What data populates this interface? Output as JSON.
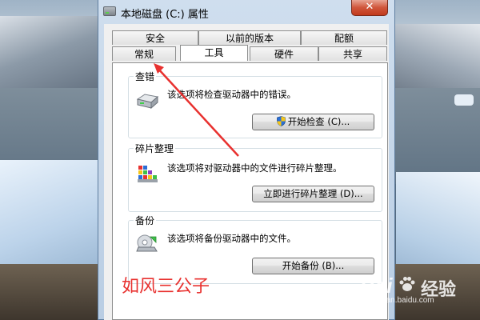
{
  "window": {
    "title": "本地磁盘 (C:) 属性",
    "close_label": "✕"
  },
  "tabs": {
    "row_back": [
      "安全",
      "以前的版本",
      "配额"
    ],
    "row_front": [
      "常规",
      "工具",
      "硬件",
      "共享"
    ],
    "active": "工具"
  },
  "groups": {
    "check": {
      "title": "查错",
      "description": "该选项将检查驱动器中的错误。",
      "button": "开始检查 (C)..."
    },
    "defrag": {
      "title": "碎片整理",
      "description": "该选项将对驱动器中的文件进行碎片整理。",
      "button": "立即进行碎片整理 (D)..."
    },
    "backup": {
      "title": "备份",
      "description": "该选项将备份驱动器中的文件。",
      "button": "开始备份 (B)..."
    }
  },
  "annotation": {
    "watermark": "如风三公子",
    "arrow_color": "#e8312f"
  },
  "baidu": {
    "brand": "Bai",
    "brand2": "经验",
    "url": "jingyan.baidu.com"
  },
  "icons": {
    "drive": "hard-drive-icon",
    "shield": "uac-shield-icon",
    "defrag": "defrag-icon",
    "backup": "backup-icon"
  }
}
